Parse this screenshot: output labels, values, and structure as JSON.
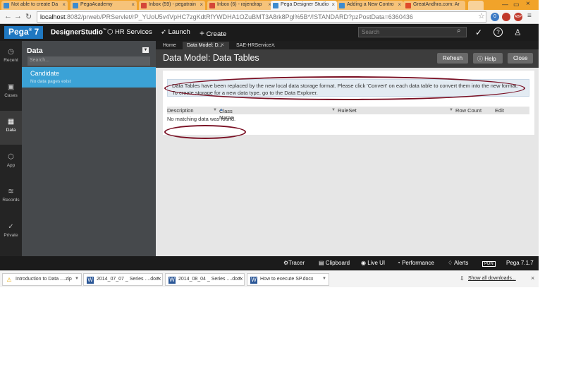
{
  "browser": {
    "tabs": [
      {
        "label": "Not able to create Da",
        "favcolor": "#3d8bcf"
      },
      {
        "label": "PegaAcademy",
        "favcolor": "#3d8bcf"
      },
      {
        "label": "Inbox (59) - pegatrain",
        "favcolor": "#d44638"
      },
      {
        "label": "Inbox (6) - rajendrap",
        "favcolor": "#d44638"
      },
      {
        "label": "Pega Designer Studio",
        "favcolor": "#3d8bcf"
      },
      {
        "label": "Adding a New Contro",
        "favcolor": "#3d8bcf"
      },
      {
        "label": "GreatAndhra.com: Ar",
        "favcolor": "#e04a2a"
      }
    ],
    "url_host": "localhost",
    "url_rest": ":8082/prweb/PRServlet/rP_YUoU5v4VpHC7zgKdtRfYWDHA1OZuBMT3A8rk8Pgl%5B*/!STANDARD?pzPostData=6360436",
    "ext_badge_1": "0",
    "ext_badge_2": "ABP"
  },
  "pega_header": {
    "logo": "Pega",
    "logo_version": "7",
    "studio": "DesignerStudio",
    "app": "HR Services",
    "launch": "Launch",
    "create": "Create",
    "search_placeholder": "Search"
  },
  "rail": [
    {
      "label": "Recent",
      "icon": "clock-icon",
      "glyph": "◷"
    },
    {
      "label": "Cases",
      "icon": "briefcase-icon",
      "glyph": "▣"
    },
    {
      "label": "Data",
      "icon": "grid-icon",
      "glyph": "▦"
    },
    {
      "label": "App",
      "icon": "cube-icon",
      "glyph": "⬡"
    },
    {
      "label": "Records",
      "icon": "layers-icon",
      "glyph": "≋"
    },
    {
      "label": "Private",
      "icon": "check-icon",
      "glyph": "✓"
    }
  ],
  "explorer": {
    "title": "Data",
    "search_placeholder": "Search...",
    "selected_item": "Candidate",
    "selected_sub": "No data pages exist"
  },
  "workspace": {
    "tabs": [
      "Home",
      "Data Model: D...",
      "SAE-HRService..."
    ],
    "title": "Data Model: Data Tables",
    "refresh": "Refresh",
    "help": "Help",
    "close": "Close",
    "notice": "Data Tables have been replaced by the new local data storage format. Please click 'Convert' on each data table to convert them into the new format. To create storage for a new data type, go to the Data Explorer.",
    "columns": [
      "Description",
      "Class Name",
      "RuleSet",
      "Row Count",
      "Edit"
    ],
    "empty_message": "No matching data was found."
  },
  "footer": {
    "tracer": "Tracer",
    "clipboard": "Clipboard",
    "live_ui": "Live UI",
    "performance": "Performance",
    "alerts": "Alerts",
    "pdn": "PDN",
    "version": "Pega 7.1.7"
  },
  "downloads": {
    "items": [
      {
        "label": "Introduction to Data ....zip",
        "icon": "warning-icon"
      },
      {
        "label": "2014_07_07 _ Series ....docx",
        "icon": "word-doc-icon"
      },
      {
        "label": "2014_08_04 _ Series ....docx",
        "icon": "word-doc-icon"
      },
      {
        "label": "How to execute SP.docx",
        "icon": "word-doc-icon"
      }
    ],
    "show_all": "Show all downloads..."
  }
}
